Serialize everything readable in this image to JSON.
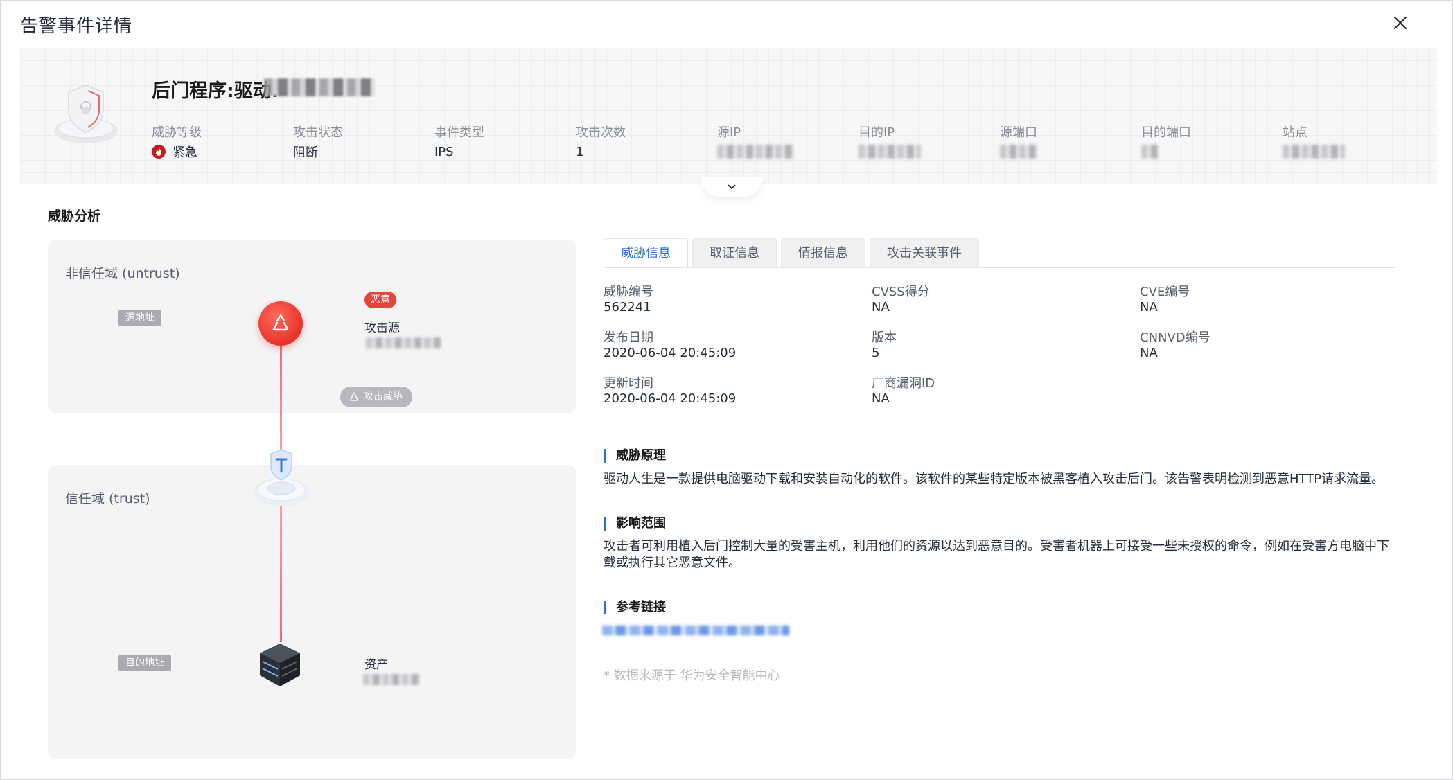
{
  "dialog": {
    "title": "告警事件详情"
  },
  "event": {
    "title": "后门程序:驱动.",
    "meta": [
      {
        "label": "威胁等级",
        "value": "紧急"
      },
      {
        "label": "攻击状态",
        "value": "阻断"
      },
      {
        "label": "事件类型",
        "value": "IPS"
      },
      {
        "label": "攻击次数",
        "value": "1"
      },
      {
        "label": "源IP",
        "value": ""
      },
      {
        "label": "目的IP",
        "value": ""
      },
      {
        "label": "源端口",
        "value": ""
      },
      {
        "label": "目的端口",
        "value": ""
      },
      {
        "label": "站点",
        "value": ""
      }
    ]
  },
  "threat_analysis": {
    "title": "威胁分析",
    "untrust_zone": "非信任域 (untrust)",
    "trust_zone": "信任域 (trust)",
    "source_pill": "源地址",
    "dest_pill": "目的地址",
    "malicious_badge": "恶意",
    "attacker_label": "攻击源",
    "attack_threat_label": "攻击威胁",
    "asset_label": "资产"
  },
  "tabs": [
    "威胁信息",
    "取证信息",
    "情报信息",
    "攻击关联事件"
  ],
  "threat_info": {
    "threat_id": {
      "label": "威胁编号",
      "value": "562241"
    },
    "cvss": {
      "label": "CVSS得分",
      "value": "NA"
    },
    "cve": {
      "label": "CVE编号",
      "value": "NA"
    },
    "publish_date": {
      "label": "发布日期",
      "value": "2020-06-04 20:45:09"
    },
    "version": {
      "label": "版本",
      "value": "5"
    },
    "cnnvd": {
      "label": "CNNVD编号",
      "value": "NA"
    },
    "update_time": {
      "label": "更新时间",
      "value": "2020-06-04 20:45:09"
    },
    "vendor_id": {
      "label": "厂商漏洞ID",
      "value": "NA"
    }
  },
  "principle": {
    "title": "威胁原理",
    "text": "驱动人生是一款提供电脑驱动下载和安装自动化的软件。该软件的某些特定版本被黑客植入攻击后门。该告警表明检测到恶意HTTP请求流量。"
  },
  "impact": {
    "title": "影响范围",
    "text": "攻击者可利用植入后门控制大量的受害主机，利用他们的资源以达到恶意目的。受害者机器上可接受一些未授权的命令，例如在受害方电脑中下载或执行其它恶意文件。"
  },
  "reference": {
    "title": "参考链接"
  },
  "source_note": "* 数据来源于 华为安全智能中心",
  "colors": {
    "accent": "#2b6fd6",
    "danger": "#e8322a",
    "line": "#f26b6b"
  }
}
